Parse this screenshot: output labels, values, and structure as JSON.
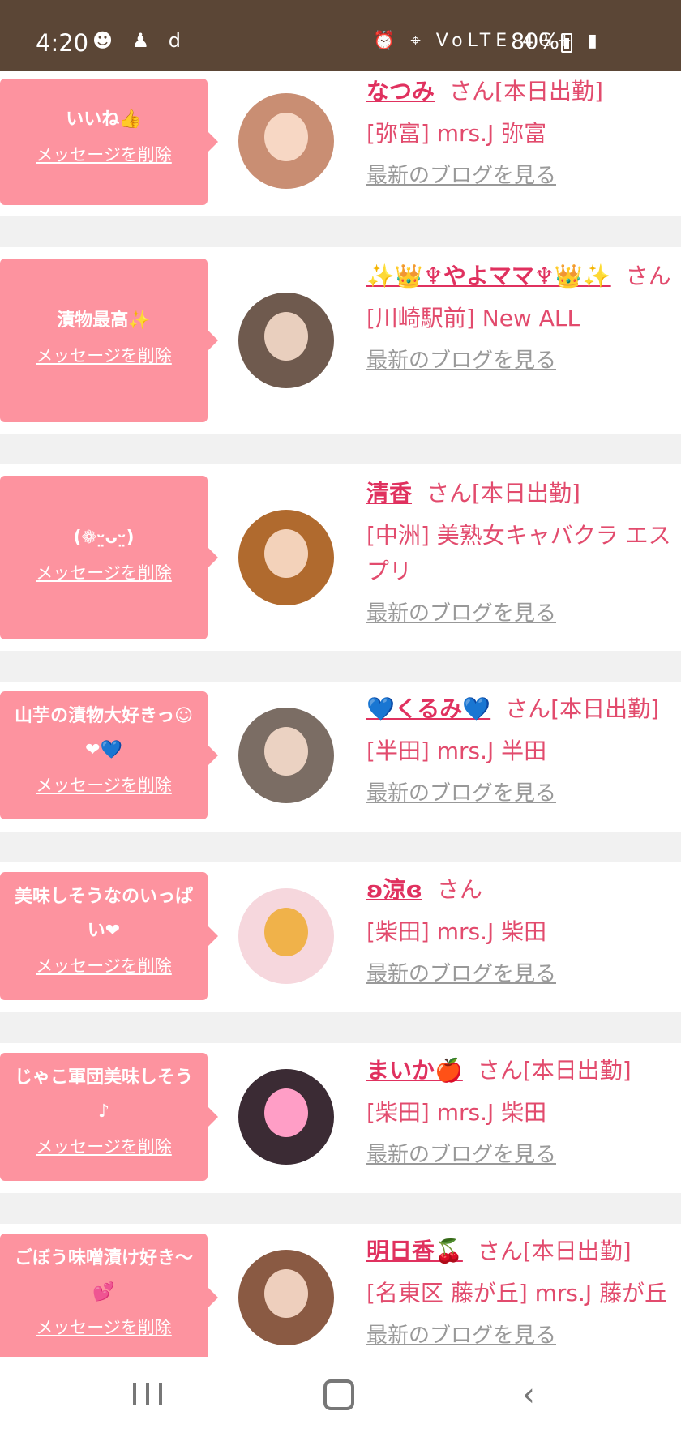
{
  "status_bar": {
    "time": "4:20",
    "left_icons": "☻ ♟ d",
    "right_icons": "⏰ ⌖ VoLTE 4G+ ▮",
    "battery": "80%"
  },
  "rows": [
    {
      "message": "いいね👍",
      "delete_label": "メッセージを削除",
      "name": "なつみ",
      "suffix": "さん[本日出勤]",
      "shop": "[弥富] mrs.J 弥富",
      "blog_label": "最新のブログを見る",
      "avatar_color": "#c98e73"
    },
    {
      "message": "漬物最高✨",
      "delete_label": "メッセージを削除",
      "name": "✨👑♆やよママ♆👑✨",
      "suffix": "さん",
      "shop": "[川崎駅前] New ALL",
      "blog_label": "最新のブログを見る",
      "avatar_color": "#6f5a4e"
    },
    {
      "message": "(❁ᵕ̤ᴗᵕ̤)",
      "delete_label": "メッセージを削除",
      "name": "清香",
      "suffix": "さん[本日出勤]",
      "shop": "[中洲] 美熟女キャバクラ エスプリ",
      "blog_label": "最新のブログを見る",
      "avatar_color": "#b06a2e"
    },
    {
      "message": "山芋の漬物大好きっ☺❤💙",
      "delete_label": "メッセージを削除",
      "name": "💙くるみ💙",
      "suffix": "さん[本日出勤]",
      "shop": "[半田] mrs.J 半田",
      "blog_label": "最新のブログを見る",
      "avatar_color": "#7b6d64"
    },
    {
      "message": "美味しそうなのいっぱい❤",
      "delete_label": "メッセージを削除",
      "name": "ʚ涼ɞ",
      "suffix": "さん",
      "shop": "[柴田] mrs.J 柴田",
      "blog_label": "最新のブログを見る",
      "avatar_color": "#f6d7dd"
    },
    {
      "message": "じゃこ軍団美味しそう♪",
      "delete_label": "メッセージを削除",
      "name": "まいか🍎",
      "suffix": "さん[本日出勤]",
      "shop": "[柴田] mrs.J 柴田",
      "blog_label": "最新のブログを見る",
      "avatar_color": "#3b2b34"
    },
    {
      "message": "ごぼう味噌漬け好き〜💕",
      "delete_label": "メッセージを削除",
      "name": "明日香🍒",
      "suffix": "さん[本日出勤]",
      "shop": "[名東区 藤が丘] mrs.J 藤が丘",
      "blog_label": "最新のブログを見る",
      "avatar_color": "#8a5a43"
    }
  ],
  "nav": {
    "recents_icon": "recents-icon",
    "home_icon": "home-icon",
    "back_label": "‹"
  },
  "colors": {
    "status_bar": "#5b4636",
    "bubble": "#fd939f",
    "name": "#e0315f",
    "shop": "#e24b6d",
    "blog": "#999999"
  }
}
